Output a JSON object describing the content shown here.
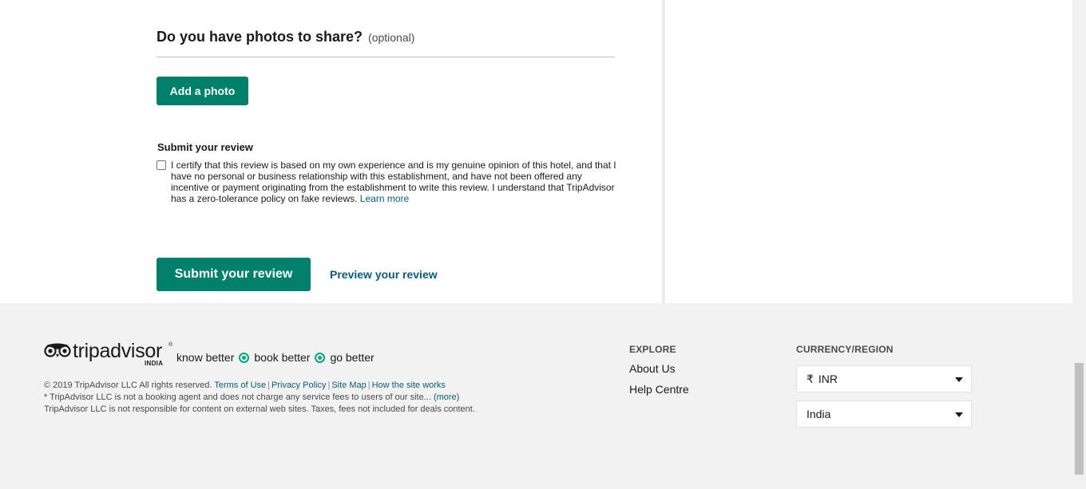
{
  "photos": {
    "heading": "Do you have photos to share?",
    "optional": "(optional)",
    "add_button": "Add a photo"
  },
  "submit_section": {
    "title": "Submit your review",
    "certify_text": "I certify that this review is based on my own experience and is my genuine opinion of this hotel, and that I have no personal or business relationship with this establishment, and have not been offered any incentive or payment originating from the establishment to write this review. I understand that TripAdvisor has a zero-tolerance policy on fake reviews.",
    "learn_more": "Learn more",
    "certified": false,
    "submit_button": "Submit your review",
    "preview_link": "Preview your review"
  },
  "footer": {
    "logo_word": "tripadvisor",
    "logo_region": "INDIA",
    "logo_reg_mark": "®",
    "tagline": {
      "part1": "know better",
      "part2": "book better",
      "part3": "go better"
    },
    "legal": {
      "copyright": "© 2019 TripAdvisor LLC All rights reserved.",
      "links": [
        "Terms of Use",
        "Privacy Policy",
        "Site Map",
        "How the site works"
      ],
      "disclaimer": "* TripAdvisor LLC is not a booking agent and does not charge any service fees to users of our site...",
      "more": "(more)",
      "content_note": "TripAdvisor LLC is not responsible for content on external web sites. Taxes, fees not included for deals content."
    },
    "explore": {
      "title": "EXPLORE",
      "links": [
        "About Us",
        "Help Centre"
      ]
    },
    "currency_region": {
      "title": "CURRENCY/REGION",
      "currency_symbol": "₹",
      "currency": "INR",
      "region": "India"
    }
  },
  "colors": {
    "brand_green": "#00806a",
    "tagline_green": "#00a680",
    "link_blue": "#0b5b7d",
    "footer_bg": "#f2f2f2"
  },
  "icons": [
    "owl-logo-icon",
    "tagline-dot-icon",
    "dropdown-arrow-icon",
    "checkbox-icon"
  ]
}
